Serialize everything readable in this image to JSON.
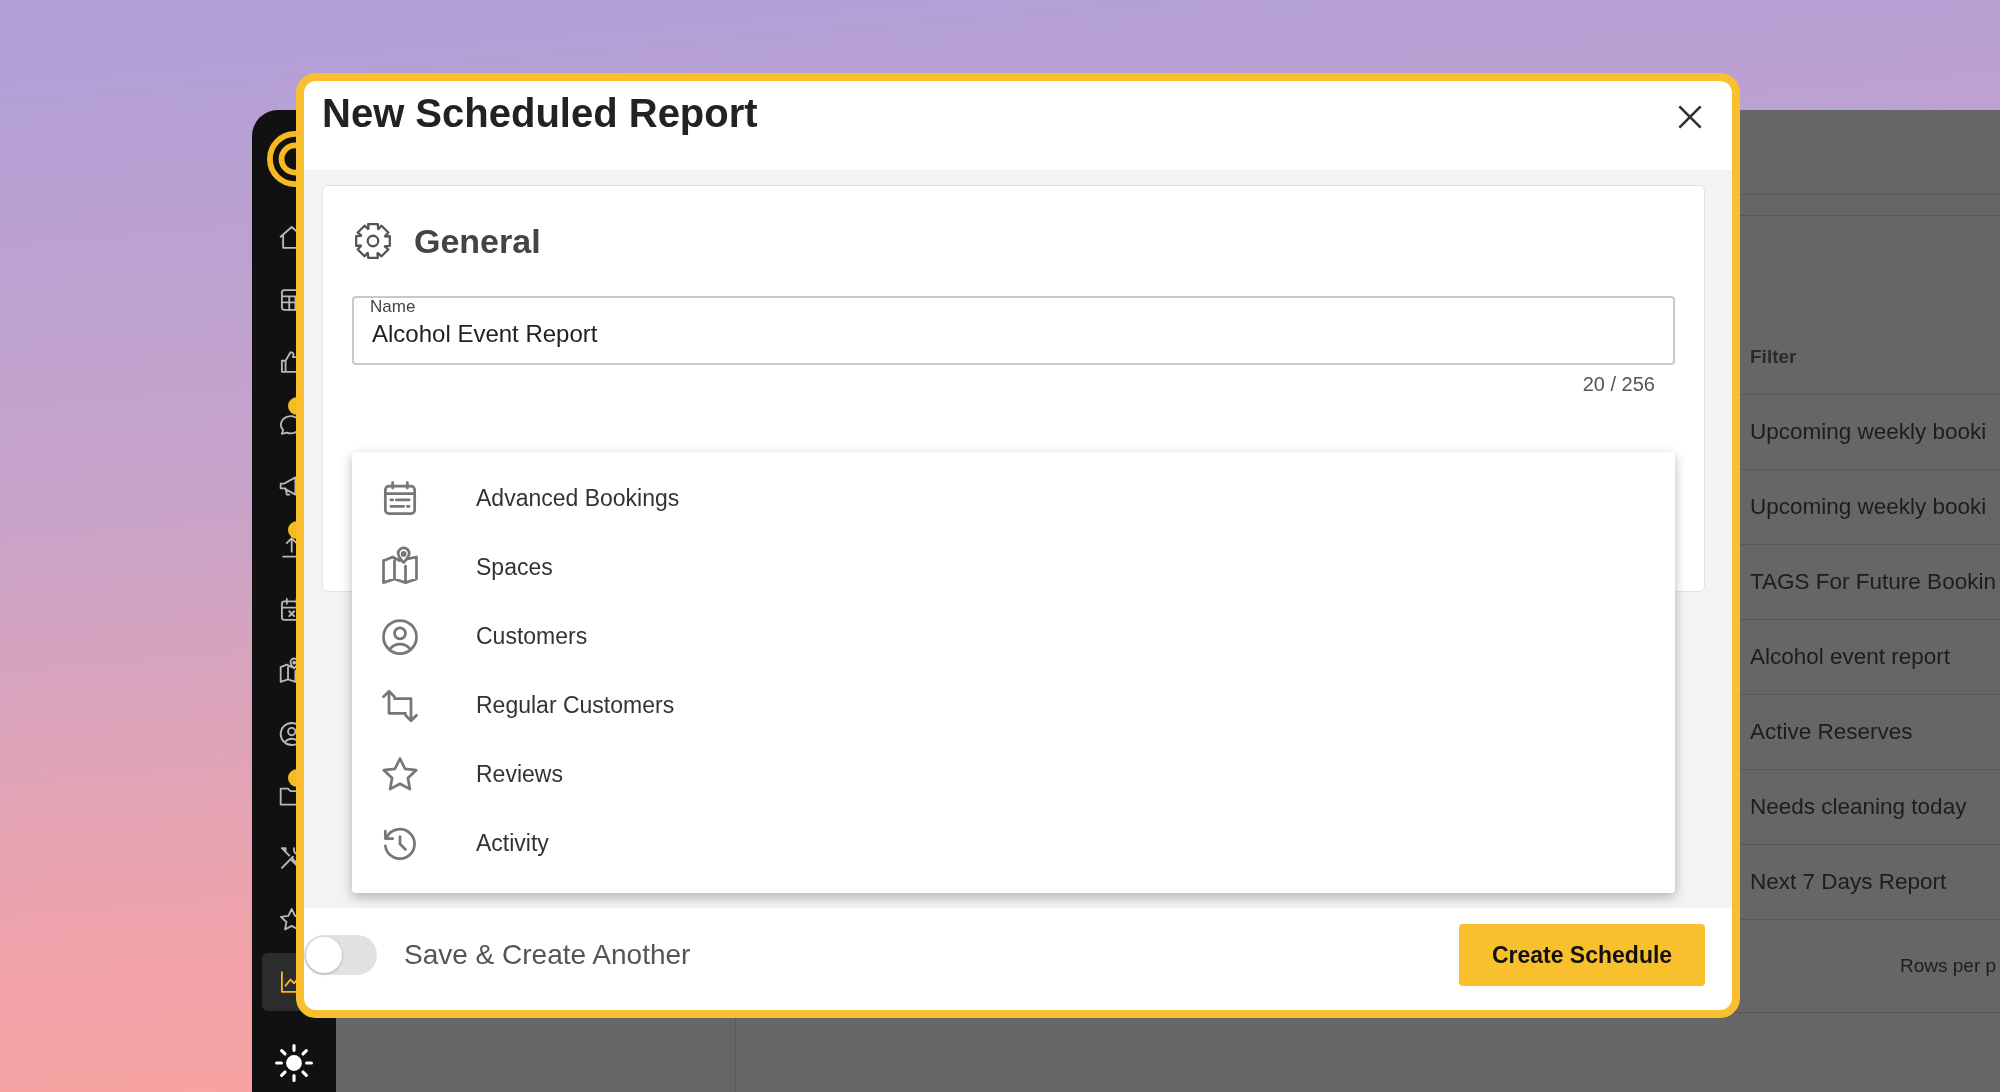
{
  "app": {
    "sidebar": {
      "items": [
        {
          "kind": "home",
          "selected": false,
          "badge": false
        },
        {
          "kind": "table",
          "selected": false,
          "badge": false
        },
        {
          "kind": "thumb",
          "selected": false,
          "badge": false
        },
        {
          "kind": "chat",
          "selected": false,
          "badge": true
        },
        {
          "kind": "megaphone",
          "selected": false,
          "badge": false
        },
        {
          "kind": "export",
          "selected": false,
          "badge": true
        },
        {
          "kind": "calendar-x",
          "selected": false,
          "badge": false
        },
        {
          "kind": "map",
          "selected": false,
          "badge": false
        },
        {
          "kind": "user",
          "selected": false,
          "badge": false
        },
        {
          "kind": "folder",
          "selected": false,
          "badge": true
        },
        {
          "kind": "tools",
          "selected": false,
          "badge": false
        },
        {
          "kind": "star",
          "selected": false,
          "badge": false
        },
        {
          "kind": "chart",
          "selected": true,
          "badge": false
        }
      ]
    },
    "table": {
      "columns": [
        "Filter"
      ],
      "rows": [
        "Upcoming weekly booki",
        "Upcoming weekly booki",
        "TAGS For Future Bookin",
        "Alcohol event report",
        "Active Reserves",
        "Needs cleaning today",
        "Next 7 Days Report"
      ],
      "pagination": "Rows per p"
    }
  },
  "dialog": {
    "title": "New Scheduled Report",
    "section": {
      "title": "General",
      "name_field": {
        "label": "Name",
        "value": "Alcohol Event Report",
        "counter": "20 / 256"
      }
    },
    "dropdown": {
      "options": [
        {
          "kind": "calendar",
          "label": "Advanced Bookings"
        },
        {
          "kind": "map",
          "label": "Spaces"
        },
        {
          "kind": "user",
          "label": "Customers"
        },
        {
          "kind": "repeat",
          "label": "Regular Customers"
        },
        {
          "kind": "star",
          "label": "Reviews"
        },
        {
          "kind": "history",
          "label": "Activity"
        }
      ]
    },
    "footer": {
      "toggle": {
        "label": "Save & Create Another",
        "on": false
      },
      "button": "Create Schedule"
    }
  }
}
